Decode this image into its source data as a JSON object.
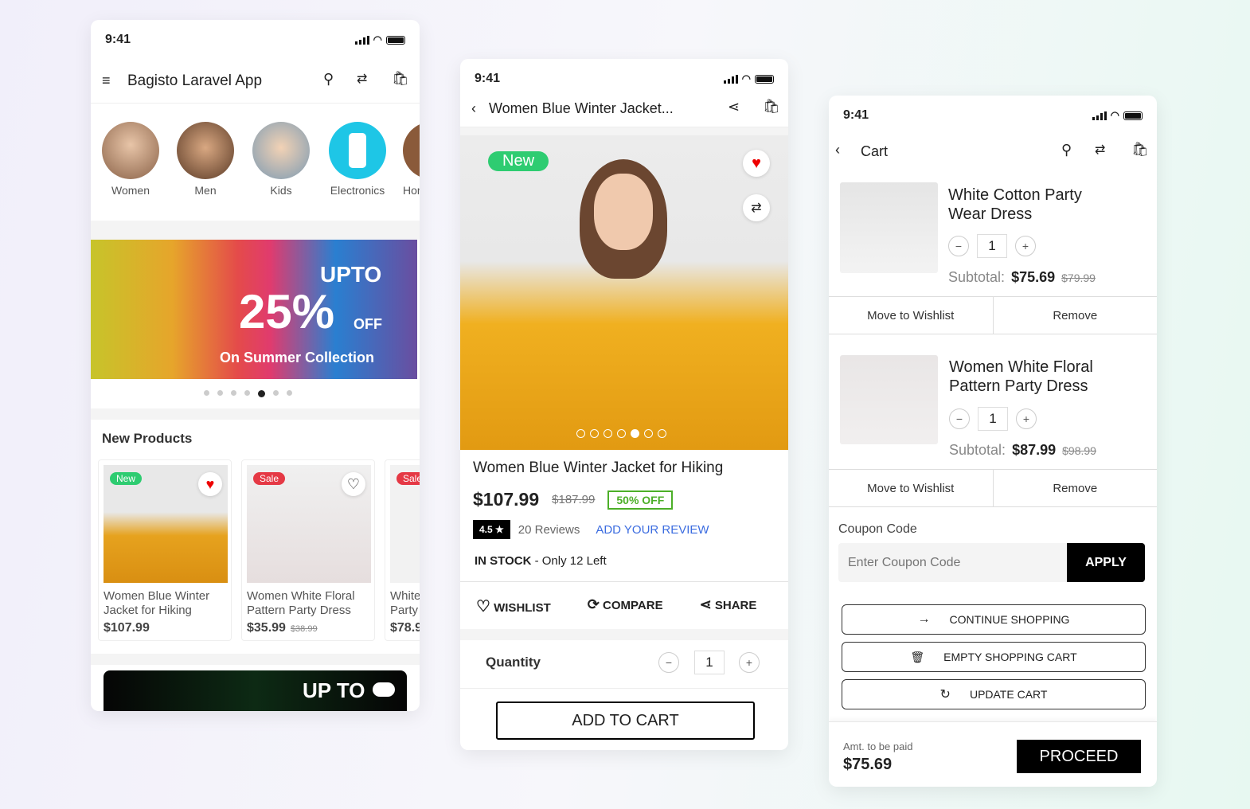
{
  "status_time": "9:41",
  "home": {
    "title": "Bagisto Laravel App",
    "categories": [
      {
        "label": "Women"
      },
      {
        "label": "Men"
      },
      {
        "label": "Kids"
      },
      {
        "label": "Electronics"
      },
      {
        "label": "Hom"
      }
    ],
    "banner": {
      "line1": "UPTO",
      "line2": "25%",
      "line3": "OFF",
      "line4": "On Summer Collection",
      "slides": 7,
      "active_slide": 5
    },
    "section_title": "New Products",
    "products": [
      {
        "badge": "New",
        "badge_color": "#2ecc71",
        "name": "Women Blue Winter Jacket for Hiking",
        "price": "$107.99",
        "old_price": "",
        "wishlisted": true
      },
      {
        "badge": "Sale",
        "badge_color": "#e53945",
        "name": "Women White Floral Pattern Party Dress",
        "price": "$35.99",
        "old_price": "$38.99",
        "wishlisted": false
      },
      {
        "badge": "Sale",
        "badge_color": "#e53945",
        "name": "White Party",
        "price": "$78.9",
        "old_price": "",
        "wishlisted": false
      }
    ],
    "banner2": "UP TO"
  },
  "product": {
    "header_title": "Women Blue Winter Jacket...",
    "badge": "New",
    "slides": 7,
    "active_slide": 5,
    "name": "Women Blue Winter Jacket for Hiking",
    "price": "$107.99",
    "old_price": "$187.99",
    "discount": "50% OFF",
    "rating": "4.5",
    "reviews": "20 Reviews",
    "add_review": "ADD YOUR REVIEW",
    "stock_label": "IN STOCK",
    "stock_text": " - Only 12 Left",
    "actions": {
      "wishlist": "WISHLIST",
      "compare": "COMPARE",
      "share": "SHARE"
    },
    "quantity_label": "Quantity",
    "quantity": "1",
    "add_to_cart": "ADD TO CART"
  },
  "cart": {
    "title": "Cart",
    "items": [
      {
        "name": "White Cotton Party Wear Dress",
        "qty": "1",
        "subtotal_label": "Subtotal:",
        "subtotal": "$75.69",
        "old": "$79.99",
        "move": "Move to Wishlist",
        "remove": "Remove"
      },
      {
        "name": "Women White Floral Pattern Party Dress",
        "qty": "1",
        "subtotal_label": "Subtotal:",
        "subtotal": "$87.99",
        "old": "$98.99",
        "move": "Move to Wishlist",
        "remove": "Remove"
      }
    ],
    "coupon_label": "Coupon Code",
    "coupon_placeholder": "Enter Coupon Code",
    "apply": "APPLY",
    "continue": "CONTINUE SHOPPING",
    "empty": "EMPTY SHOPPING CART",
    "update": "UPDATE CART",
    "amount_label": "Amt. to be paid",
    "amount": "$75.69",
    "proceed": "PROCEED"
  },
  "colors": {
    "accent_green": "#2ecc71",
    "sale_red": "#e53945",
    "link_blue": "#3b6ce0",
    "discount_green": "#4caf28"
  }
}
